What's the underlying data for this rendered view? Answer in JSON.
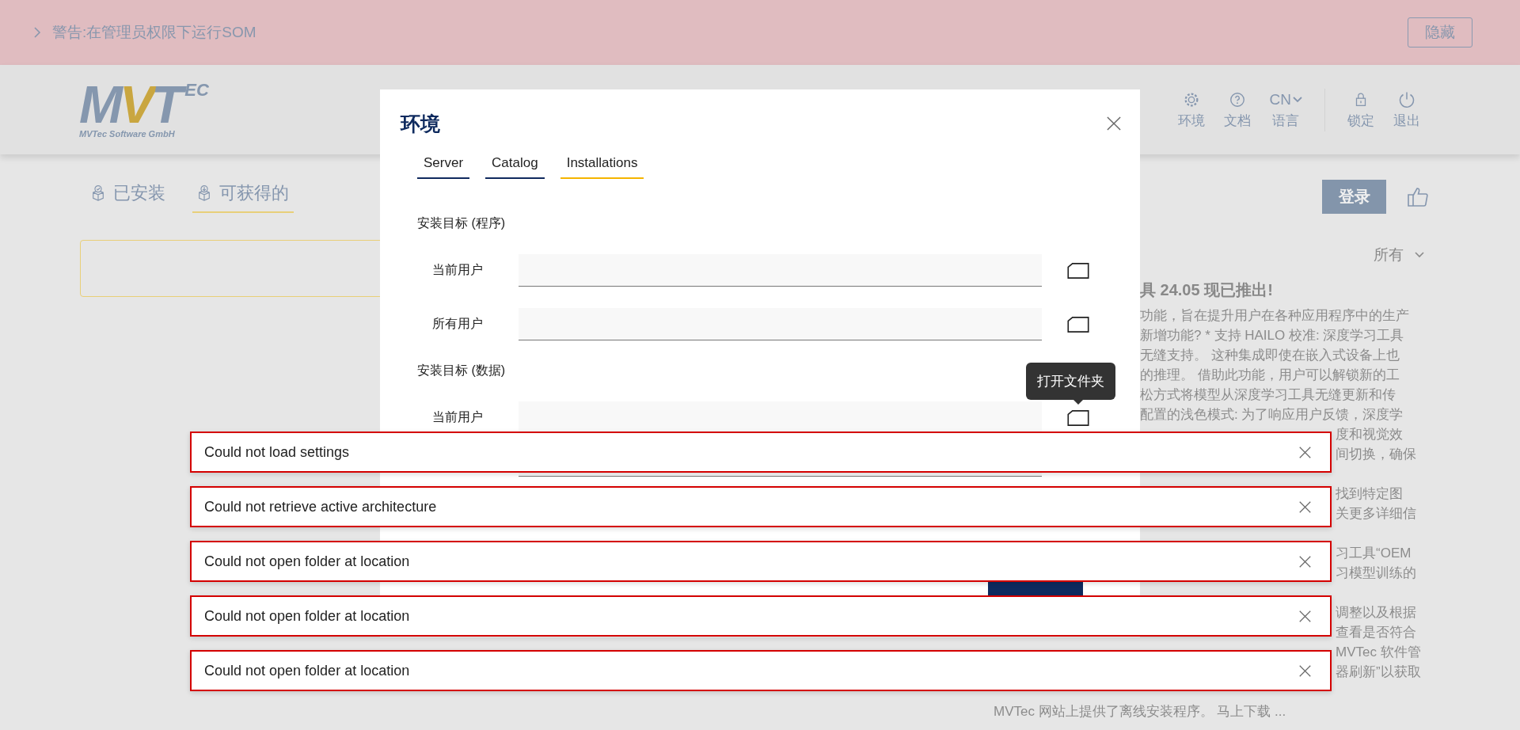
{
  "banner": {
    "message": "警告:在管理员权限下运行SOM",
    "hide_button": "隐藏"
  },
  "header": {
    "logo": {
      "mark": "MVT",
      "superscript": "EC",
      "caption": "MVTec Software GmbH"
    },
    "nav": [
      {
        "kind": "gear",
        "label": "环境"
      },
      {
        "kind": "help",
        "label": "文档"
      },
      {
        "kind": "language",
        "code": "CN",
        "label": "语言"
      },
      {
        "kind": "lock",
        "label": "锁定"
      },
      {
        "kind": "power",
        "label": "退出"
      }
    ]
  },
  "page_tabs": [
    {
      "kind": "installed",
      "label": "已安装",
      "selected": false
    },
    {
      "kind": "available",
      "label": "可获得的",
      "selected": true
    }
  ],
  "login_button": "登录",
  "filter": {
    "value": "所有"
  },
  "news": {
    "title": "具 24.05 现已推出!",
    "lines": [
      {
        "kind": "after_dialog",
        "text": "功能，旨在提升用户在各种应用程序中的生产"
      },
      {
        "kind": "after_dialog",
        "text": "新增功能? * 支持 HAILO 校准: 深度学习工具"
      },
      {
        "kind": "after_dialog",
        "text": "无缝支持。 这种集成即使在嵌入式设备上也"
      },
      {
        "kind": "after_dialog",
        "text": "的推理。 借助此功能，用户可以解锁新的工"
      },
      {
        "kind": "after_dialog",
        "text": "松方式将模型从深度学习工具无缝更新和传"
      },
      {
        "kind": "after_dialog",
        "text": "配置的浅色模式: 为了响应用户反馈，深度学"
      },
      {
        "kind": "after_toast",
        "text": "度和视觉效"
      },
      {
        "kind": "after_toast",
        "text": "间切换，确保"
      },
      {
        "kind": "after_toast",
        "text": "找到特定图",
        "skip_before": true
      },
      {
        "kind": "after_toast",
        "text": "关更多详细信"
      },
      {
        "kind": "after_toast",
        "text": "习工具“OEM",
        "skip_before": true
      },
      {
        "kind": "after_toast",
        "text": "习模型训练的"
      },
      {
        "kind": "after_toast",
        "text": "调整以及根据",
        "skip_before": true
      },
      {
        "kind": "after_toast",
        "text": "查看是否符合"
      },
      {
        "kind": "after_toast",
        "text": "MVTec 软件管"
      },
      {
        "kind": "after_toast",
        "text": "器刷新”以获取"
      },
      {
        "kind": "full",
        "text": "MVTec 网站上提供了离线安装程序。 马上下载 ...",
        "skip_before": true
      }
    ]
  },
  "dialog": {
    "title": "环境",
    "tabs": [
      {
        "label": "Server",
        "selected": false
      },
      {
        "label": "Catalog",
        "selected": false
      },
      {
        "label": "Installations",
        "selected": true
      }
    ],
    "sections": [
      {
        "heading": "安装目标 (程序)",
        "rows": [
          {
            "label": "当前用户"
          },
          {
            "label": "所有用户"
          }
        ]
      },
      {
        "heading": "安装目标 (数据)",
        "rows": [
          {
            "label": "当前用户",
            "tooltip": "打开文件夹"
          }
        ]
      }
    ]
  },
  "toasts": [
    {
      "message": "Could not load settings"
    },
    {
      "message": "Could not retrieve active architecture"
    },
    {
      "message": "Could not open folder at location"
    },
    {
      "message": "Could not open folder at location"
    },
    {
      "message": "Could not open folder at location"
    }
  ]
}
